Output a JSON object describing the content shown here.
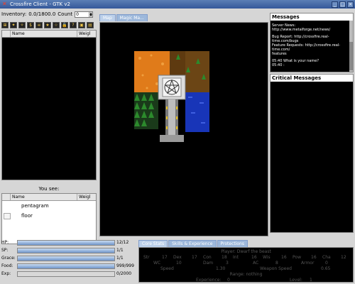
{
  "window": {
    "title": "Crossfire Client - GTK v2"
  },
  "inventory": {
    "label": "Inventory:",
    "weight": "0.0/1800.0",
    "count_label": "Count",
    "count_value": "0",
    "columns": {
      "name": "Name",
      "weight": "Weigl"
    }
  },
  "map_tabs": [
    "Map",
    "Magic Ma..."
  ],
  "you_see": {
    "label": "You see:",
    "columns": {
      "name": "Name",
      "weight": "Weigl"
    },
    "items": [
      {
        "name": "pentagram",
        "icon": "pentagram-icon"
      },
      {
        "name": "floor",
        "icon": "floor-icon"
      }
    ]
  },
  "messages": {
    "header": "Messages",
    "lines": [
      "Server News: http://www.metalforge.net/news/",
      "",
      "Bug Report: http://crossfire.real-time.com/bugs",
      "Feature Requests: http://crossfire.real-time.com/",
      "features",
      "",
      "05:40 What is your name?",
      "05:40 :"
    ]
  },
  "critical": {
    "header": "Critical Messages"
  },
  "stats": [
    {
      "label": "HP:",
      "value": "12/12",
      "fraction": 1.0
    },
    {
      "label": "SP:",
      "value": "1/1",
      "fraction": 1.0
    },
    {
      "label": "Grace:",
      "value": "1/1",
      "fraction": 1.0
    },
    {
      "label": "Food:",
      "value": "999/999",
      "fraction": 1.0
    },
    {
      "label": "Exp:",
      "value": "0/2000",
      "fraction": 0.0
    }
  ],
  "stats_tabs": [
    "Core Stats",
    "Skills & Experience",
    "Protections"
  ],
  "core_stats": {
    "player": "Player: Dwarf the beast",
    "attrs": [
      {
        "k": "Str",
        "v": "17"
      },
      {
        "k": "Dex",
        "v": "17"
      },
      {
        "k": "Con",
        "v": "18"
      },
      {
        "k": "Int",
        "v": "16"
      },
      {
        "k": "Wis",
        "v": "16"
      },
      {
        "k": "Pow",
        "v": "16"
      },
      {
        "k": "Cha",
        "v": "12"
      }
    ],
    "combat": [
      {
        "k": "WC",
        "v": "10"
      },
      {
        "k": "Dam",
        "v": "3"
      },
      {
        "k": "AC",
        "v": "8"
      },
      {
        "k": "Armor",
        "v": "0"
      }
    ],
    "speed_label": "Speed",
    "speed": "1.30",
    "weapon_speed_label": "Weapon Speed",
    "weapon_speed": "0.65",
    "range": "Range: nothing",
    "exp_label": "Experience:",
    "exp": "0",
    "level_label": "Level:",
    "level": "1"
  },
  "colors": {
    "lava": "#e07b1a",
    "grass": "#5e3a10",
    "water": "#1835b8",
    "tree": "#2c8a2c"
  }
}
